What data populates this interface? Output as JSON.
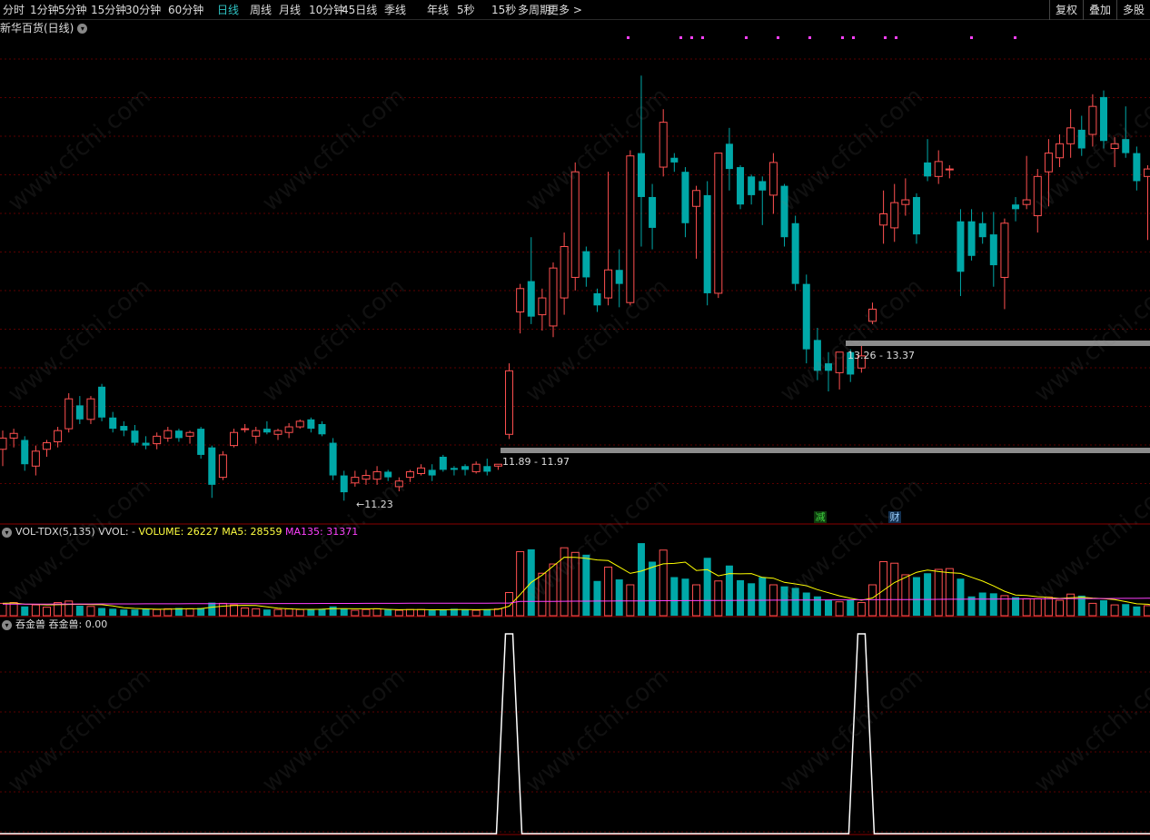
{
  "toolbar": {
    "periods": [
      "分时",
      "1分钟",
      "5分钟",
      "15分钟",
      "30分钟",
      "60分钟",
      "日线",
      "周线",
      "月线",
      "10分钟",
      "45日线",
      "季线",
      "年线",
      "5秒",
      "15秒",
      "多周期",
      "更多 >"
    ],
    "active_period": "日线",
    "right_buttons": [
      "复权",
      "叠加",
      "多股"
    ]
  },
  "stock": {
    "title": "新华百货(日线)"
  },
  "price_labels": {
    "low": "←11.23",
    "zone1": "11.89 - 11.97",
    "zone2": "13.26 - 13.37"
  },
  "signals": {
    "jian": "减",
    "cai": "财"
  },
  "vol_indicator": {
    "name": "VOL-TDX(5,135)",
    "vvol": "VVOL: -",
    "volume": "VOLUME: 26227",
    "ma5": "MA5: 28559",
    "ma135": "MA135: 31371"
  },
  "tjs_indicator": {
    "name": "吞金兽",
    "value": "吞金兽: 0.00"
  },
  "watermark_text": "www.cfchi.com",
  "colors": {
    "up": "#ff5050",
    "down": "#00a8a8",
    "ma5": "#ffff00",
    "ma135": "#ff40ff",
    "zone": "#8c8c8c",
    "active": "#2fc3c3",
    "grid": "#5a0000"
  },
  "chart_data": {
    "type": "candlestick",
    "candles": [
      {
        "o": 11.78,
        "h": 11.98,
        "l": 11.6,
        "c": 11.9
      },
      {
        "o": 11.9,
        "h": 12.0,
        "l": 11.8,
        "c": 11.95
      },
      {
        "o": 11.88,
        "h": 11.92,
        "l": 11.55,
        "c": 11.62
      },
      {
        "o": 11.6,
        "h": 11.82,
        "l": 11.5,
        "c": 11.76
      },
      {
        "o": 11.78,
        "h": 11.88,
        "l": 11.7,
        "c": 11.85
      },
      {
        "o": 11.86,
        "h": 12.02,
        "l": 11.8,
        "c": 11.98
      },
      {
        "o": 12.0,
        "h": 12.38,
        "l": 11.96,
        "c": 12.32
      },
      {
        "o": 12.25,
        "h": 12.35,
        "l": 12.05,
        "c": 12.1
      },
      {
        "o": 12.1,
        "h": 12.35,
        "l": 12.05,
        "c": 12.32
      },
      {
        "o": 12.45,
        "h": 12.48,
        "l": 12.08,
        "c": 12.12
      },
      {
        "o": 12.12,
        "h": 12.18,
        "l": 11.96,
        "c": 12.0
      },
      {
        "o": 12.03,
        "h": 12.08,
        "l": 11.92,
        "c": 11.98
      },
      {
        "o": 11.98,
        "h": 12.04,
        "l": 11.82,
        "c": 11.85
      },
      {
        "o": 11.85,
        "h": 11.92,
        "l": 11.78,
        "c": 11.82
      },
      {
        "o": 11.84,
        "h": 11.96,
        "l": 11.78,
        "c": 11.92
      },
      {
        "o": 11.9,
        "h": 12.02,
        "l": 11.86,
        "c": 11.98
      },
      {
        "o": 11.98,
        "h": 12.0,
        "l": 11.86,
        "c": 11.9
      },
      {
        "o": 11.92,
        "h": 11.98,
        "l": 11.84,
        "c": 11.96
      },
      {
        "o": 12.0,
        "h": 12.02,
        "l": 11.68,
        "c": 11.72
      },
      {
        "o": 11.8,
        "h": 11.82,
        "l": 11.26,
        "c": 11.4
      },
      {
        "o": 11.48,
        "h": 11.76,
        "l": 11.45,
        "c": 11.72
      },
      {
        "o": 11.82,
        "h": 12.0,
        "l": 11.8,
        "c": 11.96
      },
      {
        "o": 12.0,
        "h": 12.05,
        "l": 11.96,
        "c": 12.0
      },
      {
        "o": 11.92,
        "h": 12.02,
        "l": 11.84,
        "c": 11.98
      },
      {
        "o": 12.0,
        "h": 12.08,
        "l": 11.94,
        "c": 11.96
      },
      {
        "o": 11.94,
        "h": 12.0,
        "l": 11.88,
        "c": 11.98
      },
      {
        "o": 11.96,
        "h": 12.06,
        "l": 11.9,
        "c": 12.02
      },
      {
        "o": 12.02,
        "h": 12.1,
        "l": 12.0,
        "c": 12.08
      },
      {
        "o": 12.1,
        "h": 12.12,
        "l": 11.96,
        "c": 12.0
      },
      {
        "o": 12.05,
        "h": 12.08,
        "l": 11.92,
        "c": 11.94
      },
      {
        "o": 11.85,
        "h": 11.9,
        "l": 11.45,
        "c": 11.5
      },
      {
        "o": 11.5,
        "h": 11.55,
        "l": 11.23,
        "c": 11.32
      },
      {
        "o": 11.42,
        "h": 11.55,
        "l": 11.38,
        "c": 11.48
      },
      {
        "o": 11.46,
        "h": 11.56,
        "l": 11.4,
        "c": 11.5
      },
      {
        "o": 11.46,
        "h": 11.6,
        "l": 11.4,
        "c": 11.54
      },
      {
        "o": 11.54,
        "h": 11.56,
        "l": 11.44,
        "c": 11.48
      },
      {
        "o": 11.38,
        "h": 11.48,
        "l": 11.33,
        "c": 11.44
      },
      {
        "o": 11.48,
        "h": 11.56,
        "l": 11.43,
        "c": 11.54
      },
      {
        "o": 11.52,
        "h": 11.62,
        "l": 11.5,
        "c": 11.58
      },
      {
        "o": 11.56,
        "h": 11.62,
        "l": 11.44,
        "c": 11.5
      },
      {
        "o": 11.7,
        "h": 11.72,
        "l": 11.54,
        "c": 11.56
      },
      {
        "o": 11.58,
        "h": 11.6,
        "l": 11.5,
        "c": 11.56
      },
      {
        "o": 11.6,
        "h": 11.62,
        "l": 11.5,
        "c": 11.56
      },
      {
        "o": 11.54,
        "h": 11.65,
        "l": 11.52,
        "c": 11.62
      },
      {
        "o": 11.6,
        "h": 11.68,
        "l": 11.5,
        "c": 11.54
      },
      {
        "o": 11.6,
        "h": 11.62,
        "l": 11.56,
        "c": 11.62
      },
      {
        "o": 11.94,
        "h": 12.7,
        "l": 11.89,
        "c": 12.62
      },
      {
        "o": 13.25,
        "h": 13.55,
        "l": 13.02,
        "c": 13.5
      },
      {
        "o": 13.58,
        "h": 14.05,
        "l": 13.12,
        "c": 13.2
      },
      {
        "o": 13.22,
        "h": 13.5,
        "l": 13.05,
        "c": 13.4
      },
      {
        "o": 13.1,
        "h": 13.78,
        "l": 12.98,
        "c": 13.72
      },
      {
        "o": 13.4,
        "h": 14.1,
        "l": 13.22,
        "c": 13.95
      },
      {
        "o": 13.62,
        "h": 14.85,
        "l": 13.48,
        "c": 14.75
      },
      {
        "o": 13.9,
        "h": 13.95,
        "l": 13.52,
        "c": 13.62
      },
      {
        "o": 13.45,
        "h": 13.5,
        "l": 13.25,
        "c": 13.32
      },
      {
        "o": 13.4,
        "h": 14.75,
        "l": 13.32,
        "c": 13.7
      },
      {
        "o": 13.7,
        "h": 13.92,
        "l": 13.3,
        "c": 13.55
      },
      {
        "o": 13.35,
        "h": 14.98,
        "l": 13.32,
        "c": 14.92
      },
      {
        "o": 14.95,
        "h": 15.78,
        "l": 13.95,
        "c": 14.48
      },
      {
        "o": 14.48,
        "h": 14.62,
        "l": 13.92,
        "c": 14.15
      },
      {
        "o": 14.8,
        "h": 15.42,
        "l": 14.7,
        "c": 15.28
      },
      {
        "o": 14.9,
        "h": 14.95,
        "l": 14.75,
        "c": 14.85
      },
      {
        "o": 14.75,
        "h": 14.8,
        "l": 14.05,
        "c": 14.2
      },
      {
        "o": 14.38,
        "h": 14.6,
        "l": 13.82,
        "c": 14.55
      },
      {
        "o": 14.5,
        "h": 14.65,
        "l": 13.32,
        "c": 13.45
      },
      {
        "o": 13.45,
        "h": 14.95,
        "l": 13.4,
        "c": 14.95
      },
      {
        "o": 15.05,
        "h": 15.22,
        "l": 14.55,
        "c": 14.78
      },
      {
        "o": 14.8,
        "h": 14.82,
        "l": 14.35,
        "c": 14.4
      },
      {
        "o": 14.7,
        "h": 14.72,
        "l": 14.4,
        "c": 14.5
      },
      {
        "o": 14.65,
        "h": 14.7,
        "l": 14.18,
        "c": 14.55
      },
      {
        "o": 14.5,
        "h": 14.95,
        "l": 14.3,
        "c": 14.85
      },
      {
        "o": 14.6,
        "h": 14.62,
        "l": 13.95,
        "c": 14.05
      },
      {
        "o": 14.2,
        "h": 14.28,
        "l": 13.48,
        "c": 13.55
      },
      {
        "o": 13.55,
        "h": 13.65,
        "l": 12.7,
        "c": 12.85
      },
      {
        "o": 12.95,
        "h": 13.08,
        "l": 12.52,
        "c": 12.62
      },
      {
        "o": 12.7,
        "h": 12.82,
        "l": 12.4,
        "c": 12.62
      },
      {
        "o": 12.6,
        "h": 12.82,
        "l": 12.42,
        "c": 12.82
      },
      {
        "o": 12.82,
        "h": 12.85,
        "l": 12.5,
        "c": 12.58
      },
      {
        "o": 12.65,
        "h": 12.9,
        "l": 12.6,
        "c": 12.78
      },
      {
        "o": 13.15,
        "h": 13.35,
        "l": 13.12,
        "c": 13.28
      },
      {
        "o": 14.18,
        "h": 14.55,
        "l": 13.98,
        "c": 14.3
      },
      {
        "o": 14.15,
        "h": 14.62,
        "l": 14.0,
        "c": 14.42
      },
      {
        "o": 14.4,
        "h": 14.68,
        "l": 14.28,
        "c": 14.45
      },
      {
        "o": 14.48,
        "h": 14.52,
        "l": 13.98,
        "c": 14.08
      },
      {
        "o": 14.85,
        "h": 15.1,
        "l": 14.65,
        "c": 14.7
      },
      {
        "o": 14.7,
        "h": 14.98,
        "l": 14.62,
        "c": 14.86
      },
      {
        "o": 14.78,
        "h": 14.82,
        "l": 14.68,
        "c": 14.78
      },
      {
        "o": 14.22,
        "h": 14.35,
        "l": 13.42,
        "c": 13.68
      },
      {
        "o": 14.22,
        "h": 14.35,
        "l": 13.8,
        "c": 13.85
      },
      {
        "o": 14.2,
        "h": 14.32,
        "l": 13.98,
        "c": 14.05
      },
      {
        "o": 14.08,
        "h": 14.32,
        "l": 13.52,
        "c": 13.75
      },
      {
        "o": 13.62,
        "h": 14.25,
        "l": 13.28,
        "c": 14.2
      },
      {
        "o": 14.4,
        "h": 14.48,
        "l": 14.22,
        "c": 14.35
      },
      {
        "o": 14.4,
        "h": 14.92,
        "l": 14.35,
        "c": 14.45
      },
      {
        "o": 14.28,
        "h": 14.78,
        "l": 14.1,
        "c": 14.7
      },
      {
        "o": 14.75,
        "h": 15.1,
        "l": 14.38,
        "c": 14.95
      },
      {
        "o": 14.9,
        "h": 15.15,
        "l": 14.8,
        "c": 15.05
      },
      {
        "o": 15.05,
        "h": 15.42,
        "l": 14.9,
        "c": 15.22
      },
      {
        "o": 15.2,
        "h": 15.35,
        "l": 14.92,
        "c": 15.0
      },
      {
        "o": 15.15,
        "h": 15.58,
        "l": 15.02,
        "c": 15.45
      },
      {
        "o": 15.55,
        "h": 15.62,
        "l": 15.0,
        "c": 15.08
      },
      {
        "o": 15.0,
        "h": 15.12,
        "l": 14.8,
        "c": 15.05
      },
      {
        "o": 15.1,
        "h": 15.45,
        "l": 14.9,
        "c": 14.95
      },
      {
        "o": 14.95,
        "h": 15.02,
        "l": 14.55,
        "c": 14.65
      },
      {
        "o": 14.7,
        "h": 14.82,
        "l": 14.02,
        "c": 14.78
      },
      {
        "o": 14.82,
        "h": 14.95,
        "l": 14.6,
        "c": 14.88
      },
      {
        "o": 14.9,
        "h": 14.95,
        "l": 14.72,
        "c": 14.78
      },
      {
        "o": 14.78,
        "h": 14.82,
        "l": 14.48,
        "c": 14.5
      },
      {
        "o": 14.62,
        "h": 14.68,
        "l": 14.45,
        "c": 14.55
      },
      {
        "o": 14.4,
        "h": 14.48,
        "l": 14.1,
        "c": 14.28
      },
      {
        "o": 14.22,
        "h": 14.32,
        "l": 13.9,
        "c": 14.12
      }
    ],
    "volume": [
      16000,
      17000,
      12000,
      14000,
      11000,
      17000,
      19000,
      13000,
      12000,
      10000,
      9000,
      8000,
      8000,
      9000,
      8000,
      9000,
      10000,
      9000,
      10000,
      17000,
      16000,
      14000,
      10000,
      9000,
      8000,
      8000,
      9000,
      8000,
      8000,
      9000,
      12000,
      9000,
      7000,
      8000,
      9000,
      8000,
      7000,
      8000,
      8000,
      7000,
      8000,
      9000,
      8000,
      7000,
      8000,
      9000,
      30000,
      83000,
      86000,
      55000,
      67000,
      88000,
      82000,
      79000,
      45000,
      63000,
      47000,
      40000,
      94000,
      70000,
      85000,
      50000,
      48000,
      40000,
      75000,
      45000,
      65000,
      46000,
      42000,
      50000,
      40000,
      38000,
      36000,
      30000,
      25000,
      20000,
      18000,
      20000,
      17000,
      40000,
      70000,
      68000,
      53000,
      50000,
      55000,
      60000,
      61000,
      48000,
      25000,
      30000,
      29000,
      26000,
      24000,
      22000,
      22000,
      24000,
      20000,
      28000,
      26000,
      16000,
      20000,
      14000,
      15000,
      12000,
      13000,
      10000,
      11000,
      12000,
      10000,
      11000,
      12000
    ],
    "ma135_start": 15000,
    "ma135_end": 23000,
    "tjs_signals": [
      0,
      0,
      0,
      0,
      0,
      0,
      0,
      0,
      0,
      0,
      0,
      0,
      0,
      0,
      0,
      0,
      0,
      0,
      0,
      0,
      0,
      0,
      0,
      0,
      0,
      0,
      0,
      0,
      0,
      0,
      0,
      0,
      0,
      0,
      0,
      0,
      0,
      0,
      0,
      0,
      0,
      0,
      0,
      0,
      0,
      0,
      1,
      0,
      0,
      0,
      0,
      0,
      0,
      0,
      0,
      0,
      0,
      0,
      0,
      0,
      0,
      0,
      0,
      0,
      0,
      0,
      0,
      0,
      0,
      0,
      0,
      0,
      0,
      0,
      0,
      0,
      0,
      0,
      1,
      0,
      0,
      0,
      0,
      0,
      0,
      0,
      0,
      0,
      0,
      0,
      0,
      0,
      0,
      0,
      0,
      0,
      0,
      0,
      0,
      0,
      0,
      0,
      0,
      0,
      0,
      0,
      0,
      0,
      0,
      0,
      0
    ],
    "tjs_ylim": [
      0,
      1
    ],
    "price_ylim": [
      11.0,
      16.2
    ]
  }
}
